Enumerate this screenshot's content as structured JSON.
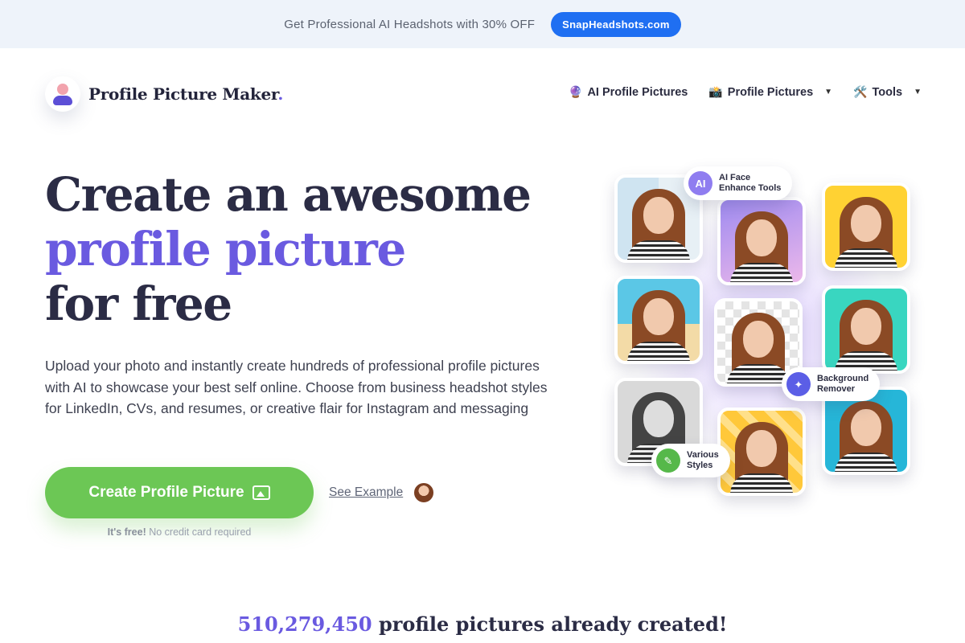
{
  "promo": {
    "text": "Get Professional AI Headshots with 30% OFF",
    "button_label": "SnapHeadshots.com"
  },
  "brand": {
    "name": "Profile Picture Maker",
    "dot": "."
  },
  "nav": {
    "items": [
      {
        "icon": "🔮",
        "label": "AI Profile Pictures",
        "dropdown": false
      },
      {
        "icon": "📸",
        "label": "Profile Pictures",
        "dropdown": true
      },
      {
        "icon": "🛠️",
        "label": "Tools",
        "dropdown": true
      }
    ],
    "caret": "▼"
  },
  "hero": {
    "title_line1": "Create an awesome",
    "title_line2": "profile picture",
    "title_line3": "for free",
    "description": "Upload your photo and instantly create hundreds of professional profile pictures with AI to showcase your best self online. Choose from business headshot styles for LinkedIn, CVs, and resumes, or creative flair for Instagram and messaging",
    "cta_label": "Create Profile Picture",
    "see_example": "See Example",
    "free_bold": "It's free!",
    "free_rest": "No credit card required"
  },
  "collage": {
    "chips": [
      {
        "icon": "AI",
        "line1": "AI Face",
        "line2": "Enhance Tools",
        "color": "#8f7df0"
      },
      {
        "icon": "✦",
        "line1": "Background",
        "line2": "Remover",
        "color": "#5b5ee6"
      },
      {
        "icon": "✎",
        "line1": "Various",
        "line2": "Styles",
        "color": "#56b84a"
      }
    ]
  },
  "stats": {
    "count": "510,279,450",
    "suffix": "profile pictures already created!"
  },
  "colors": {
    "accent": "#6a5ae0",
    "cta": "#6cc755",
    "promo_button": "#1f6ff2"
  }
}
